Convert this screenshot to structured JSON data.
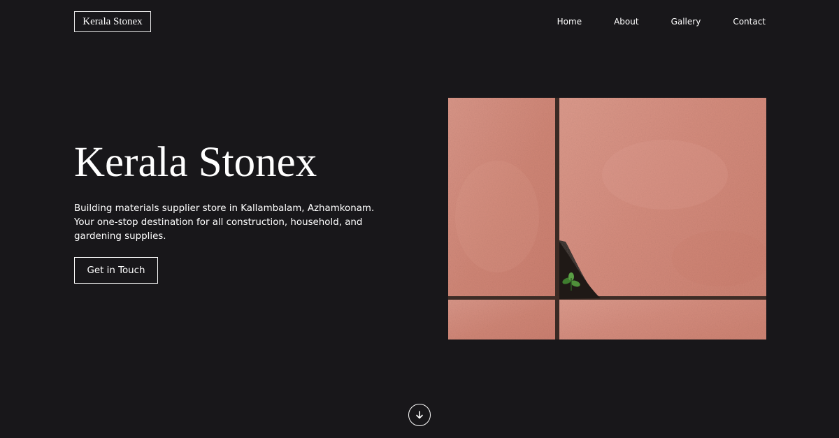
{
  "header": {
    "logo_text": "Kerala Stonex",
    "nav": [
      {
        "label": "Home"
      },
      {
        "label": "About"
      },
      {
        "label": "Gallery"
      },
      {
        "label": "Contact"
      }
    ]
  },
  "hero": {
    "title": "Kerala Stonex",
    "description_lines": [
      "Building materials supplier store in Kallambalam, Azhamkonam.",
      "Your one-stop destination for all construction, household, and",
      "gardening supplies."
    ],
    "cta_label": "Get in Touch",
    "image_icon": "stone-tiles-photo",
    "scroll_icon": "arrow-down-icon"
  },
  "colors": {
    "background": "#18171a",
    "text": "#ffffff",
    "stone": "#d38b7d"
  }
}
